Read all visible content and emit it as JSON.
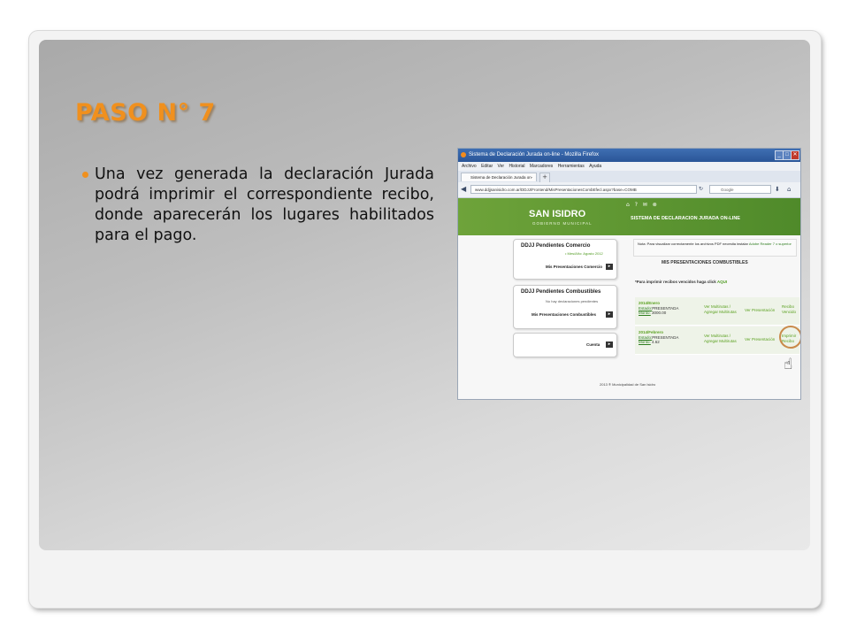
{
  "slide": {
    "title": "PASO N° 7",
    "bullet": "Una vez generada la declaración Jurada podrá imprimir el correspondiente recibo, donde aparecerán los lugares habilitados para el pago."
  },
  "browser": {
    "window_title": "Sistema de Declaración Jurada on-line - Mozilla Firefox",
    "menu": [
      "Archivo",
      "Editar",
      "Ver",
      "Historial",
      "Marcadores",
      "Herramientas",
      "Ayuda"
    ],
    "tab_label": "Sistema de Declaración Jurada on-line",
    "url": "www.ddjjsanisidro.com.ar/DDJJ/Frontend/MisPresentacionesCombEfecl.aspx?base=COMB",
    "search_engine": "Google"
  },
  "site": {
    "logo": "SAN ISIDRO",
    "logo_sub": "GOBIERNO MUNICIPAL",
    "system_title": "SISTEMA DE DECLARACION JURADA ON-LINE",
    "comercio_heading": "DDJJ Pendientes Comercio",
    "comercio_note": "• Mes/Año: Agosto 2012",
    "comercio_link": "Mis Presentaciones Comercio",
    "combustibles_heading": "DDJJ Pendientes Combustibles",
    "combustibles_note": "No hay declaraciones pendientes",
    "combustibles_link": "Mis Presentaciones Combustibles",
    "cuenta_link": "Cuenta",
    "note_text": "Nota: Para visualizar correctamente los archivos PDF necesita instalar",
    "note_link": "Adobe Reader 7 o superior",
    "mis_heading": "MIS PRESENTACIONES COMBUSTIBLES",
    "print_hint": "*Para imprimir recibos vencidos haga click",
    "print_hint_link": "AQUI",
    "rows": [
      {
        "period": "2014/Enero",
        "estado_label": "Estado:",
        "estado": "PRESENTADA",
        "monto_label": "Monto:",
        "monto": "3000.00",
        "col2": "Ver Multirutas / Agregar Multirutas",
        "col3": "Ver Presentación",
        "col4": "Recibo Vencido"
      },
      {
        "period": "2014/Febrero",
        "estado_label": "Estado:",
        "estado": "PRESENTADA",
        "monto_label": "Monto:",
        "monto": "4.62",
        "col2": "Ver Multirutas / Agregar Multirutas",
        "col3": "Ver Presentación",
        "col4": "Imprimir Recibo"
      }
    ],
    "footer": "2013 ® Municipalidad de San Isidro"
  },
  "colors": {
    "title_orange": "#f0901e",
    "banner_green": "#5a9530",
    "highlight_circle": "#c98a4a"
  }
}
